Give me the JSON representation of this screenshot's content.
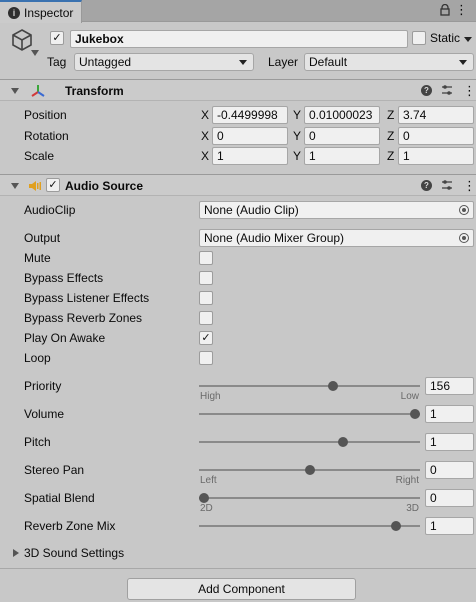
{
  "window": {
    "tab_label": "Inspector",
    "tab_icon": "info-icon",
    "menu_glyph": "⋮"
  },
  "object": {
    "name": "Jukebox",
    "active": true,
    "static_label": "Static",
    "static": false,
    "tag_label": "Tag",
    "tag_value": "Untagged",
    "layer_label": "Layer",
    "layer_value": "Default"
  },
  "transform": {
    "title": "Transform",
    "rows": [
      {
        "label": "Position",
        "x": "-0.4499998",
        "y": "0.01000023",
        "z": "3.74"
      },
      {
        "label": "Rotation",
        "x": "0",
        "y": "0",
        "z": "0"
      },
      {
        "label": "Scale",
        "x": "1",
        "y": "1",
        "z": "1"
      }
    ],
    "axes": {
      "x": "X",
      "y": "Y",
      "z": "Z"
    }
  },
  "audio_source": {
    "title": "Audio Source",
    "enabled": true,
    "audio_clip_label": "AudioClip",
    "audio_clip_value": "None (Audio Clip)",
    "output_label": "Output",
    "output_value": "None (Audio Mixer Group)",
    "toggles": [
      {
        "label": "Mute",
        "checked": false
      },
      {
        "label": "Bypass Effects",
        "checked": false
      },
      {
        "label": "Bypass Listener Effects",
        "checked": false
      },
      {
        "label": "Bypass Reverb Zones",
        "checked": false
      },
      {
        "label": "Play On Awake",
        "checked": true
      },
      {
        "label": "Loop",
        "checked": false
      }
    ],
    "sliders": [
      {
        "label": "Priority",
        "value": "156",
        "fraction": 0.61,
        "min_label": "High",
        "max_label": "Low"
      },
      {
        "label": "Volume",
        "value": "1",
        "fraction": 1.0,
        "min_label": "",
        "max_label": ""
      },
      {
        "label": "Pitch",
        "value": "1",
        "fraction": 0.66,
        "min_label": "",
        "max_label": ""
      },
      {
        "label": "Stereo Pan",
        "value": "0",
        "fraction": 0.5,
        "min_label": "Left",
        "max_label": "Right"
      },
      {
        "label": "Spatial Blend",
        "value": "0",
        "fraction": 0.0,
        "min_label": "2D",
        "max_label": "3D"
      },
      {
        "label": "Reverb Zone Mix",
        "value": "1",
        "fraction": 0.91,
        "min_label": "",
        "max_label": ""
      }
    ],
    "sound_settings_label": "3D Sound Settings"
  },
  "footer": {
    "add_component_label": "Add Component"
  },
  "colors": {
    "accent": "#3a72b0",
    "audio_icon": "#e0a020",
    "transform_x": "#d23a3a",
    "transform_y": "#3aa63a",
    "transform_z": "#3a6ad2"
  }
}
